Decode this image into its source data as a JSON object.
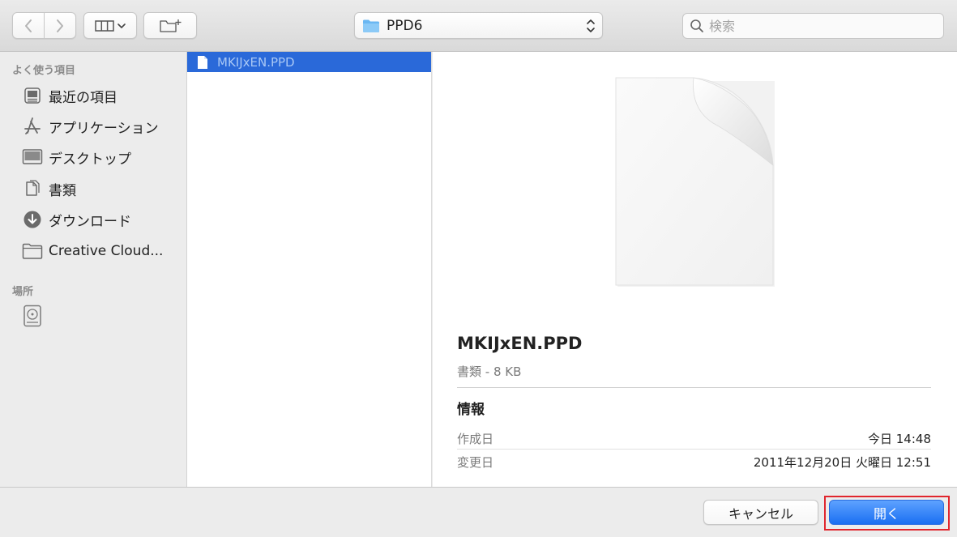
{
  "toolbar": {
    "back_icon": "chevron-left-icon",
    "forward_icon": "chevron-right-icon",
    "view_icon": "columns-view-icon",
    "new_folder_icon": "new-folder-icon",
    "path": {
      "folder_name": "PPD6",
      "icon": "folder-icon"
    },
    "search": {
      "placeholder": "検索",
      "value": ""
    }
  },
  "sidebar": {
    "favorites_title": "よく使う項目",
    "favorites": [
      {
        "label": "最近の項目",
        "icon": "recents-icon"
      },
      {
        "label": "アプリケーション",
        "icon": "applications-icon"
      },
      {
        "label": "デスクトップ",
        "icon": "desktop-icon"
      },
      {
        "label": "書類",
        "icon": "documents-icon"
      },
      {
        "label": "ダウンロード",
        "icon": "downloads-icon"
      },
      {
        "label": "Creative Cloud...",
        "icon": "folder-icon"
      }
    ],
    "locations_title": "場所",
    "locations": [
      {
        "label": "",
        "icon": "hard-drive-icon"
      }
    ]
  },
  "file_list": {
    "items": [
      {
        "name": "MKIJxEN.PPD",
        "selected": true,
        "icon": "document-icon"
      }
    ]
  },
  "preview": {
    "name": "MKIJxEN.PPD",
    "kind_size": "書類 - 8 KB",
    "info_title": "情報",
    "rows": [
      {
        "key": "作成日",
        "value": "今日 14:48"
      },
      {
        "key": "変更日",
        "value": "2011年12月20日 火曜日 12:51"
      }
    ]
  },
  "buttons": {
    "cancel": "キャンセル",
    "open": "開く"
  },
  "colors": {
    "selection": "#2a69d9",
    "primary_button": "#1a6ff2",
    "highlight": "#e0262e"
  }
}
